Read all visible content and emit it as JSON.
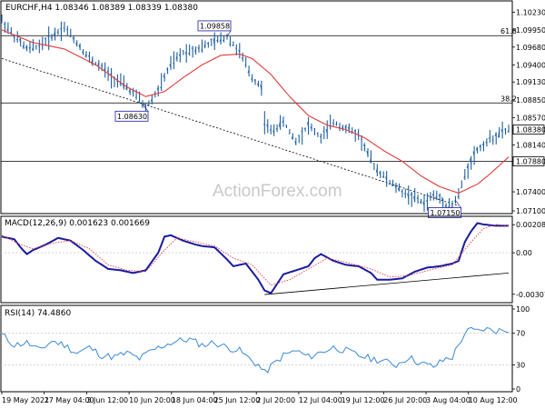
{
  "chart_data": [
    {
      "type": "line",
      "panel": "price",
      "title": "EURCHF,H4  1.08346 1.08389 1.08339 1.08380",
      "ylim": [
        1.071,
        1.1035
      ],
      "yticks": [
        "1.10230",
        "1.09950",
        "1.09680",
        "1.09400",
        "1.09130",
        "1.08850",
        "1.08570",
        "1.08380",
        "1.08140",
        "1.07880",
        "1.07400",
        "1.07100"
      ],
      "last_price_label": "1.08380",
      "level_label": "1.07880",
      "watermark": "ActionForex.com",
      "x_time_labels": [
        "19 May 2021",
        "27 May 04:00",
        "3 Jun 12:00",
        "10 Jun 20:00",
        "18 Jun 04:00",
        "25 Jun 12:00",
        "2 Jul 20:00",
        "12 Jul 04:00",
        "19 Jul 12:00",
        "26 Jul 20:00",
        "3 Aug 04:00",
        "10 Aug 12:00"
      ],
      "fib_levels": [
        {
          "label": "61.8",
          "value": 1.0986
        },
        {
          "label": "38.2",
          "value": 1.088
        },
        {
          "label": "",
          "value": 1.0788
        }
      ],
      "pivot_labels": [
        {
          "text": "1.09858",
          "bar": 72
        },
        {
          "text": "1.08630",
          "bar": 45
        },
        {
          "text": "1.07150",
          "bar": 145
        }
      ],
      "trendline": [
        {
          "bar": 0,
          "value": 1.095
        },
        {
          "bar": 146,
          "value": 1.0718
        }
      ],
      "series": [
        {
          "name": "Price",
          "color": "#1f5fa0",
          "anchors": [
            [
              0,
              1.101
            ],
            [
              4,
              1.0985
            ],
            [
              8,
              1.0965
            ],
            [
              12,
              1.097
            ],
            [
              16,
              1.0985
            ],
            [
              20,
              1.1
            ],
            [
              24,
              1.0975
            ],
            [
              28,
              1.095
            ],
            [
              32,
              1.0935
            ],
            [
              36,
              1.0918
            ],
            [
              40,
              1.0905
            ],
            [
              44,
              1.0885
            ],
            [
              46,
              1.0872
            ],
            [
              50,
              1.09
            ],
            [
              54,
              1.094
            ],
            [
              58,
              1.096
            ],
            [
              62,
              1.0965
            ],
            [
              66,
              1.0972
            ],
            [
              70,
              1.098
            ],
            [
              72,
              1.0985
            ],
            [
              76,
              1.096
            ],
            [
              80,
              1.092
            ],
            [
              83,
              1.0905
            ],
            [
              84,
              1.085
            ],
            [
              86,
              1.0835
            ],
            [
              90,
              1.085
            ],
            [
              94,
              1.082
            ],
            [
              98,
              1.0845
            ],
            [
              102,
              1.0825
            ],
            [
              106,
              1.085
            ],
            [
              110,
              1.084
            ],
            [
              114,
              1.083
            ],
            [
              118,
              1.079
            ],
            [
              120,
              1.0775
            ],
            [
              124,
              1.0755
            ],
            [
              128,
              1.074
            ],
            [
              132,
              1.073
            ],
            [
              135,
              1.0722
            ],
            [
              138,
              1.0735
            ],
            [
              140,
              1.073
            ],
            [
              142,
              1.072
            ],
            [
              144,
              1.0718
            ],
            [
              146,
              1.0735
            ],
            [
              148,
              1.0765
            ],
            [
              150,
              1.079
            ],
            [
              152,
              1.0805
            ],
            [
              154,
              1.0815
            ],
            [
              156,
              1.0822
            ],
            [
              158,
              1.0828
            ],
            [
              160,
              1.0834
            ],
            [
              162,
              1.0838
            ]
          ]
        },
        {
          "name": "SMA",
          "color": "#e23b3b",
          "anchors": [
            [
              0,
              1.0995
            ],
            [
              10,
              1.0975
            ],
            [
              20,
              1.0965
            ],
            [
              30,
              1.094
            ],
            [
              40,
              1.0905
            ],
            [
              46,
              1.089
            ],
            [
              52,
              1.0898
            ],
            [
              58,
              1.092
            ],
            [
              64,
              1.094
            ],
            [
              70,
              1.0955
            ],
            [
              76,
              1.0957
            ],
            [
              80,
              1.095
            ],
            [
              86,
              1.0925
            ],
            [
              92,
              1.089
            ],
            [
              98,
              1.086
            ],
            [
              104,
              1.0845
            ],
            [
              110,
              1.0838
            ],
            [
              116,
              1.0825
            ],
            [
              122,
              1.0805
            ],
            [
              128,
              1.0788
            ],
            [
              134,
              1.0765
            ],
            [
              140,
              1.0748
            ],
            [
              146,
              1.0738
            ],
            [
              152,
              1.0752
            ],
            [
              156,
              1.0768
            ],
            [
              162,
              1.0795
            ]
          ]
        }
      ]
    },
    {
      "type": "line",
      "panel": "macd",
      "title": "MACD(12,26,9) 0.001623 0.001669",
      "ylim": [
        -0.0035,
        0.0023
      ],
      "yticks": [
        "0.002081",
        "0.00",
        "-0.003079"
      ],
      "trendline": [
        {
          "bar": 84,
          "value": -0.0031
        },
        {
          "bar": 162,
          "value": -0.0015
        }
      ],
      "series": [
        {
          "name": "MACD",
          "color": "#1a1aa0",
          "anchors": [
            [
              0,
              0.0012
            ],
            [
              4,
              0.001
            ],
            [
              6,
              0.0004
            ],
            [
              8,
              -0.0001
            ],
            [
              10,
              0.0002
            ],
            [
              14,
              0.0006
            ],
            [
              18,
              0.0011
            ],
            [
              22,
              0.0009
            ],
            [
              26,
              0.0002
            ],
            [
              30,
              -0.0006
            ],
            [
              34,
              -0.0012
            ],
            [
              38,
              -0.0013
            ],
            [
              42,
              -0.0015
            ],
            [
              46,
              -0.0013
            ],
            [
              50,
              0.0
            ],
            [
              52,
              0.0012
            ],
            [
              54,
              0.0013
            ],
            [
              58,
              0.0009
            ],
            [
              62,
              0.0006
            ],
            [
              64,
              0.0005
            ],
            [
              68,
              0.0004
            ],
            [
              72,
              -0.0005
            ],
            [
              74,
              -0.001
            ],
            [
              78,
              -0.0008
            ],
            [
              82,
              -0.002
            ],
            [
              84,
              -0.0028
            ],
            [
              86,
              -0.003
            ],
            [
              90,
              -0.0016
            ],
            [
              94,
              -0.0013
            ],
            [
              98,
              -0.001
            ],
            [
              100,
              -0.0004
            ],
            [
              102,
              -0.0001
            ],
            [
              106,
              -0.0006
            ],
            [
              110,
              -0.0009
            ],
            [
              114,
              -0.001
            ],
            [
              118,
              -0.0015
            ],
            [
              120,
              -0.002
            ],
            [
              124,
              -0.002
            ],
            [
              128,
              -0.0019
            ],
            [
              132,
              -0.0014
            ],
            [
              136,
              -0.0011
            ],
            [
              140,
              -0.001
            ],
            [
              144,
              -0.0008
            ],
            [
              146,
              -0.0006
            ],
            [
              148,
              0.0008
            ],
            [
              150,
              0.0016
            ],
            [
              152,
              0.0022
            ],
            [
              154,
              0.0021
            ],
            [
              158,
              0.002
            ],
            [
              162,
              0.002
            ]
          ]
        },
        {
          "name": "Signal",
          "color": "#e23b3b",
          "anchors": [
            [
              0,
              0.0013
            ],
            [
              6,
              0.0006
            ],
            [
              10,
              0.0003
            ],
            [
              16,
              0.0007
            ],
            [
              22,
              0.0009
            ],
            [
              28,
              0.0003
            ],
            [
              34,
              -0.0009
            ],
            [
              40,
              -0.0013
            ],
            [
              46,
              -0.0014
            ],
            [
              52,
              0.0002
            ],
            [
              56,
              0.0011
            ],
            [
              62,
              0.0008
            ],
            [
              68,
              0.0005
            ],
            [
              74,
              -0.0004
            ],
            [
              80,
              -0.0009
            ],
            [
              86,
              -0.0024
            ],
            [
              92,
              -0.002
            ],
            [
              98,
              -0.0012
            ],
            [
              104,
              -0.0004
            ],
            [
              110,
              -0.0007
            ],
            [
              118,
              -0.0012
            ],
            [
              124,
              -0.0018
            ],
            [
              130,
              -0.0017
            ],
            [
              138,
              -0.0012
            ],
            [
              144,
              -0.0009
            ],
            [
              150,
              0.0008
            ],
            [
              154,
              0.0018
            ],
            [
              158,
              0.0021
            ],
            [
              162,
              0.002
            ]
          ]
        }
      ]
    },
    {
      "type": "line",
      "panel": "rsi",
      "title": "RSI(14) 74.4860",
      "ylim": [
        0,
        100
      ],
      "yticks": [
        "100",
        "70",
        "30",
        "0"
      ],
      "levels": [
        70,
        30
      ],
      "series": [
        {
          "name": "RSI",
          "color": "#3a8ad6",
          "anchors": [
            [
              0,
              68
            ],
            [
              4,
              55
            ],
            [
              8,
              58
            ],
            [
              12,
              48
            ],
            [
              16,
              60
            ],
            [
              20,
              55
            ],
            [
              24,
              45
            ],
            [
              28,
              52
            ],
            [
              32,
              42
            ],
            [
              36,
              40
            ],
            [
              40,
              45
            ],
            [
              44,
              38
            ],
            [
              48,
              48
            ],
            [
              52,
              55
            ],
            [
              56,
              60
            ],
            [
              60,
              62
            ],
            [
              64,
              55
            ],
            [
              68,
              58
            ],
            [
              72,
              52
            ],
            [
              76,
              48
            ],
            [
              80,
              35
            ],
            [
              82,
              30
            ],
            [
              84,
              20
            ],
            [
              86,
              28
            ],
            [
              90,
              42
            ],
            [
              94,
              48
            ],
            [
              98,
              40
            ],
            [
              102,
              46
            ],
            [
              106,
              52
            ],
            [
              110,
              48
            ],
            [
              114,
              42
            ],
            [
              118,
              38
            ],
            [
              122,
              35
            ],
            [
              126,
              30
            ],
            [
              130,
              40
            ],
            [
              134,
              32
            ],
            [
              138,
              28
            ],
            [
              142,
              38
            ],
            [
              144,
              40
            ],
            [
              146,
              55
            ],
            [
              148,
              70
            ],
            [
              150,
              74
            ],
            [
              152,
              72
            ],
            [
              154,
              75
            ],
            [
              158,
              73
            ],
            [
              162,
              74
            ]
          ]
        }
      ]
    }
  ]
}
